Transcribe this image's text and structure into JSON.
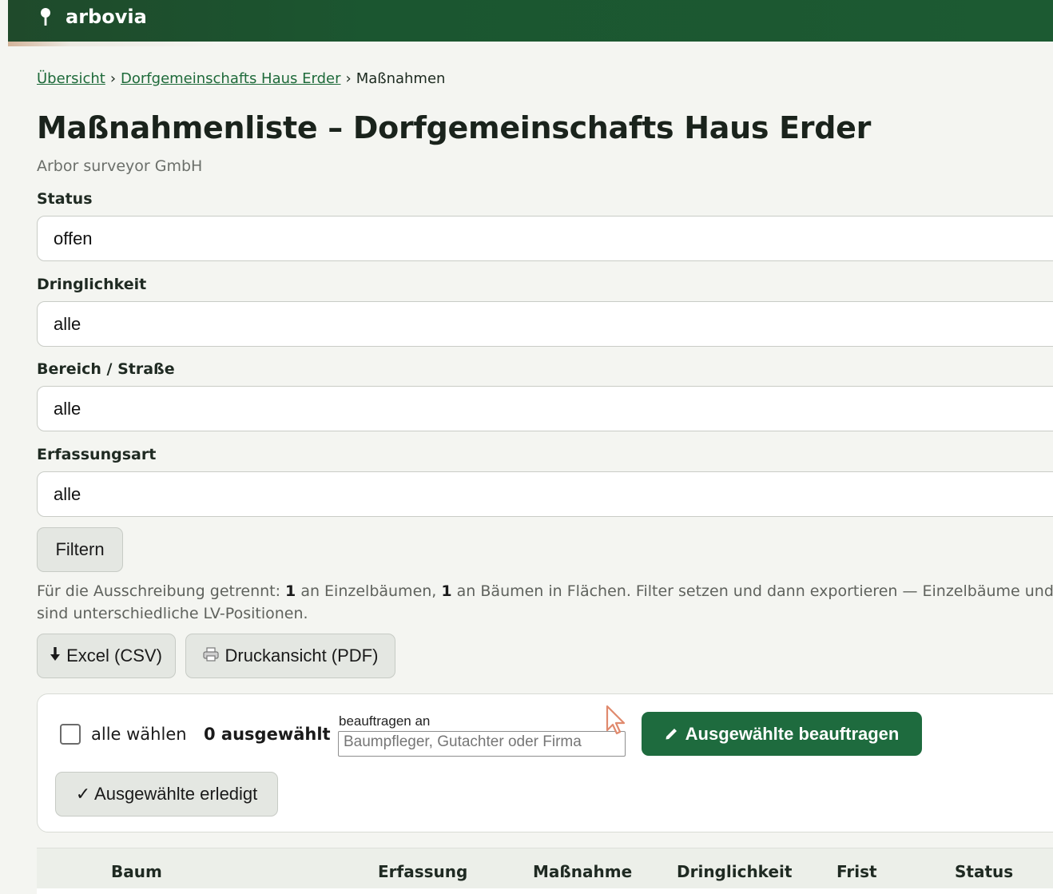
{
  "app": {
    "brand": "arbovia"
  },
  "breadcrumb": {
    "items": [
      {
        "label": "Übersicht"
      },
      {
        "label": "Dorfgemeinschafts Haus Erder"
      },
      {
        "label": "Maßnahmen"
      }
    ],
    "separator": "›"
  },
  "page": {
    "title": "Maßnahmenliste – Dorfgemeinschafts Haus Erder",
    "subtitle": "Arbor surveyor GmbH"
  },
  "filters": {
    "status": {
      "label": "Status",
      "value": "offen"
    },
    "urgency": {
      "label": "Dringlichkeit",
      "value": "alle"
    },
    "area": {
      "label": "Bereich / Straße",
      "value": "alle"
    },
    "capture_type": {
      "label": "Erfassungsart",
      "value": "alle"
    },
    "submit_label": "Filtern"
  },
  "info": {
    "prefix": "Für die Ausschreibung getrennt: ",
    "count_single": "1",
    "mid1": " an Einzelbäumen, ",
    "count_area": "1",
    "mid2": " an Bäumen in Flächen. Filter setzen und dann exportieren — Einzelbäume und Bes",
    "line2": "sind unterschiedliche LV-Positionen."
  },
  "export": {
    "csv_label": "Excel (CSV)",
    "csv_icon": "download-arrow-icon",
    "pdf_label": "Druckansicht (PDF)",
    "pdf_icon": "printer-icon"
  },
  "bulk": {
    "select_all_label": "alle wählen",
    "selected_count": "0 ausgewählt",
    "assign_label": "beauftragen an",
    "assign_placeholder": "Baumpfleger, Gutachter oder Firma",
    "assign_button": "Ausgewählte beauftragen",
    "assign_icon": "pencil-icon",
    "done_button": "✓ Ausgewählte erledigt"
  },
  "table": {
    "columns": [
      "Baum",
      "Erfassung",
      "Maßnahme",
      "Dringlichkeit",
      "Frist",
      "Status"
    ]
  },
  "colors": {
    "topbar": "#1c5a32",
    "primary": "#1e6b3e",
    "link": "#1e6a3a",
    "background": "#f4f5f1"
  }
}
